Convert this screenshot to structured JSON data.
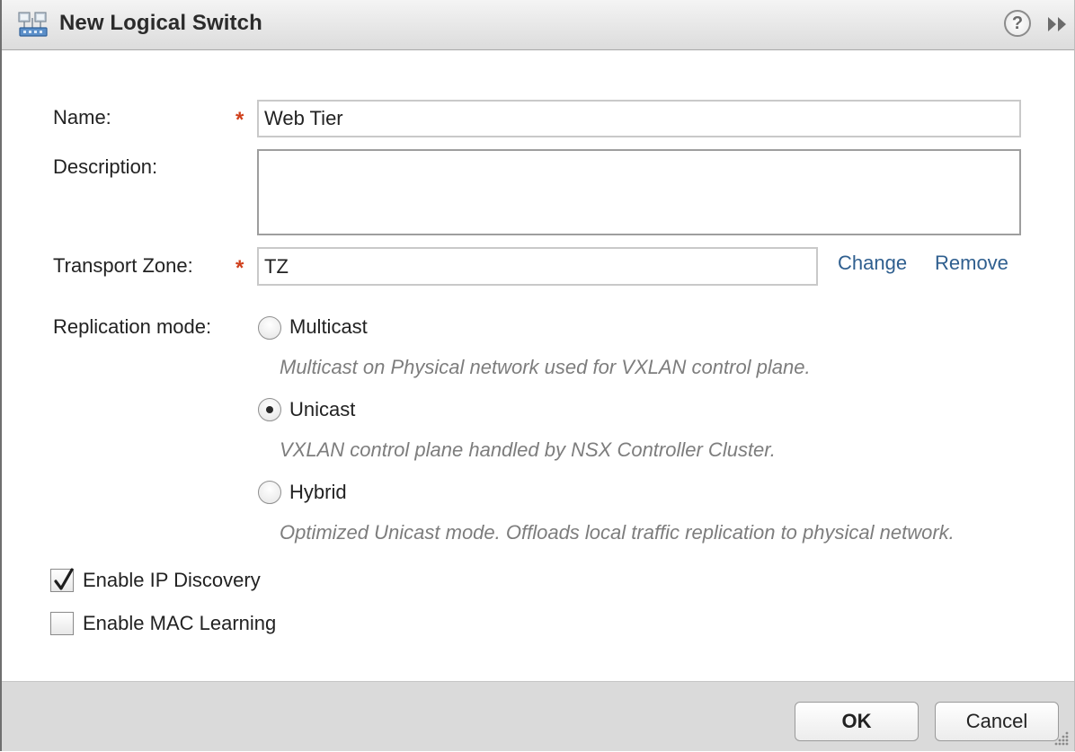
{
  "dialog": {
    "title": "New Logical Switch",
    "help_glyph": "?",
    "title_icon": "logical-switch-icon"
  },
  "form": {
    "name_label": "Name:",
    "name_value": "Web Tier",
    "description_label": "Description:",
    "description_value": "",
    "transport_zone_label": "Transport Zone:",
    "transport_zone_value": "TZ",
    "required_marker": "*",
    "change_link": "Change",
    "remove_link": "Remove",
    "replication_label": "Replication mode:",
    "replication_options": [
      {
        "label": "Multicast",
        "description": "Multicast on Physical network used for VXLAN control plane.",
        "selected": false
      },
      {
        "label": "Unicast",
        "description": "VXLAN control plane handled by NSX Controller Cluster.",
        "selected": true
      },
      {
        "label": "Hybrid",
        "description": "Optimized Unicast mode. Offloads local traffic replication to physical network.",
        "selected": false
      }
    ],
    "checkboxes": [
      {
        "label": "Enable IP Discovery",
        "checked": true
      },
      {
        "label": "Enable MAC Learning",
        "checked": false
      }
    ]
  },
  "footer": {
    "ok_label": "OK",
    "cancel_label": "Cancel"
  },
  "colors": {
    "required": "#d0401c",
    "link": "#2f5f8f",
    "description_text": "#7d7d7d",
    "footer_bg": "#dadada"
  }
}
